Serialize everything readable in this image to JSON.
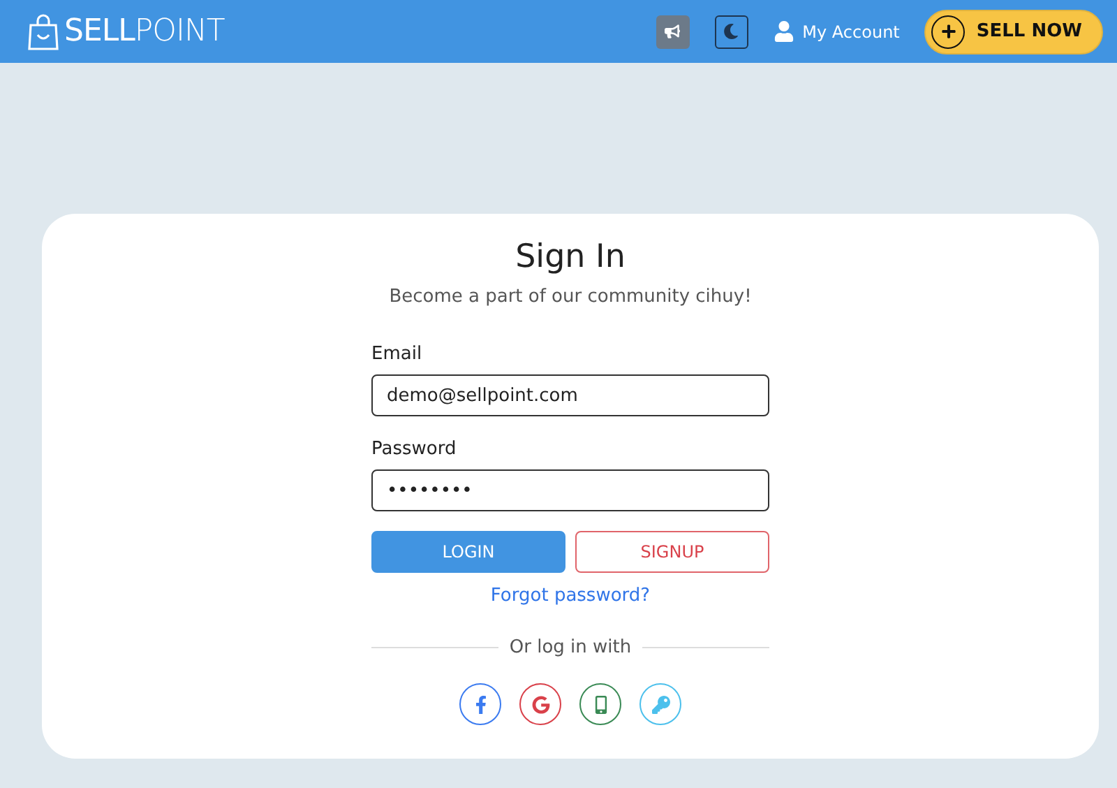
{
  "header": {
    "logo": "**SELL**POINT",
    "actions": [
      {
        "kind": "announce"
      },
      {
        "kind": "theme"
      }
    ],
    "account": {
      "label": "My Account"
    },
    "sell_button": {
      "label": "SELL NOW"
    }
  },
  "card": {
    "title": "Sign In",
    "subtitle": "Become a part of our community cihuy!",
    "fields": [
      {
        "label": "Email",
        "value": "demo@sellpoint.com"
      },
      {
        "label": "Password",
        "value": "••••••••"
      }
    ],
    "buttons": [
      {
        "kind": "primary",
        "label": "LOGIN"
      },
      {
        "kind": "outline",
        "label": "SIGNUP"
      }
    ],
    "forgot_link": "Forgot password?",
    "divider": "Or log in with",
    "social": [
      {
        "kind": "facebook",
        "color": "#3b7bf0"
      },
      {
        "kind": "google",
        "color": "#d9414a"
      },
      {
        "kind": "phone",
        "color": "#3a8a55"
      },
      {
        "kind": "key",
        "color": "#4cc0ec"
      }
    ]
  }
}
